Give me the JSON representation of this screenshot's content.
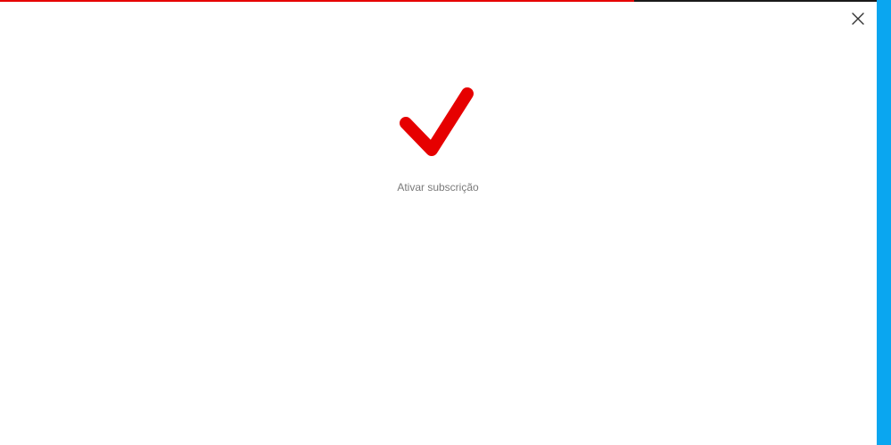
{
  "dialog": {
    "progress_fraction": 0.723,
    "status_text": "Ativar subscrição",
    "close_icon": "close-icon",
    "success_icon": "checkmark-icon"
  },
  "colors": {
    "accent": "#e60000",
    "track": "#1a1a1a",
    "text": "#7a7a7a",
    "edge": "#0aa6f0"
  }
}
